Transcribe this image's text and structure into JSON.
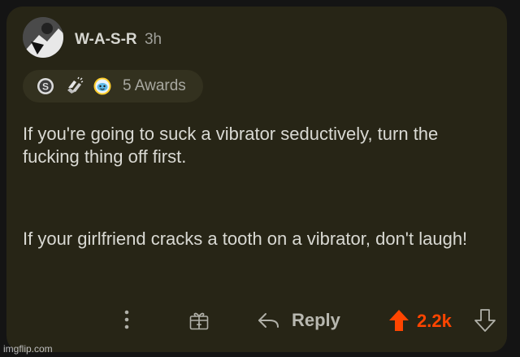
{
  "comment": {
    "author": "W-A-S-R",
    "age": "3h",
    "awards_label": "5 Awards",
    "paragraphs": [
      "If you're going to suck a vibrator seductively, turn the fucking thing off first.",
      "If your girlfriend cracks a tooth on a vibrator, don't laugh!"
    ]
  },
  "actions": {
    "reply_label": "Reply",
    "score": "2.2k"
  },
  "icons": [
    "avatar",
    "silver-award-icon",
    "clapping-hands-award-icon",
    "wholesome-award-icon",
    "more-options-icon",
    "gift-award-icon",
    "reply-arrow-icon",
    "upvote-icon",
    "downvote-icon"
  ],
  "colors": {
    "background": "#272516",
    "upvote": "#ff4500",
    "text": "#d9d9d3"
  },
  "watermark": "imgflip.com"
}
